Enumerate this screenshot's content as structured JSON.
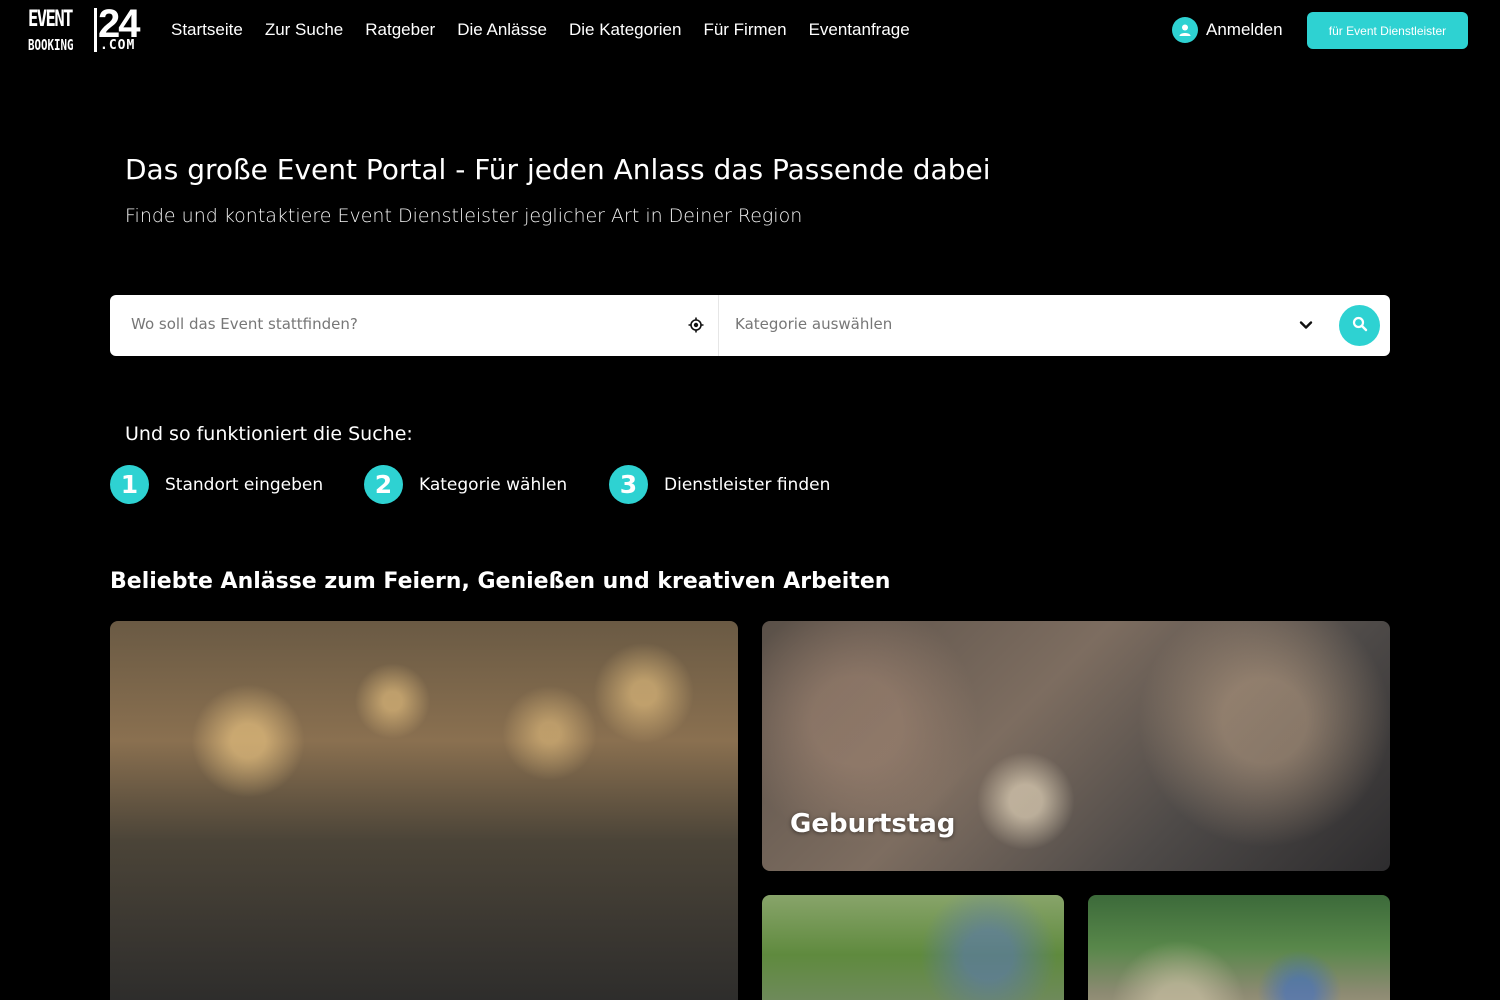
{
  "logo": {
    "event": "EVENT",
    "number": "24",
    "booking": "BOOKING",
    "domain": ".COM"
  },
  "nav": {
    "items": [
      {
        "label": "Startseite"
      },
      {
        "label": "Zur Suche"
      },
      {
        "label": "Ratgeber"
      },
      {
        "label": "Die Anlässe"
      },
      {
        "label": "Die Kategorien"
      },
      {
        "label": "Für Firmen"
      },
      {
        "label": "Eventanfrage"
      }
    ]
  },
  "header": {
    "login_label": "Anmelden",
    "login_icon": "user-icon",
    "provider_button": "für Event Dienstleister",
    "accent_color": "#2ed2d2"
  },
  "hero": {
    "title": "Das große Event Portal - Für jeden Anlass das Passende dabei",
    "subtitle": "Finde und kontaktiere Event Dienstleister jeglicher Art in Deiner Region"
  },
  "search": {
    "location_placeholder": "Wo soll das Event stattfinden?",
    "location_icon": "locate-icon",
    "category_placeholder": "Kategorie auswählen",
    "category_icon": "chevron-down-icon",
    "submit_icon": "search-icon"
  },
  "how": {
    "title": "Und so funktioniert die Suche:",
    "steps": [
      {
        "number": "1",
        "label": "Standort eingeben"
      },
      {
        "number": "2",
        "label": "Kategorie wählen"
      },
      {
        "number": "3",
        "label": "Dienstleister finden"
      }
    ]
  },
  "occasions": {
    "title": "Beliebte Anlässe zum Feiern, Genießen und kreativen Arbeiten",
    "cards": [
      {
        "label": ""
      },
      {
        "label": "Geburtstag"
      },
      {
        "label": ""
      },
      {
        "label": ""
      }
    ]
  }
}
